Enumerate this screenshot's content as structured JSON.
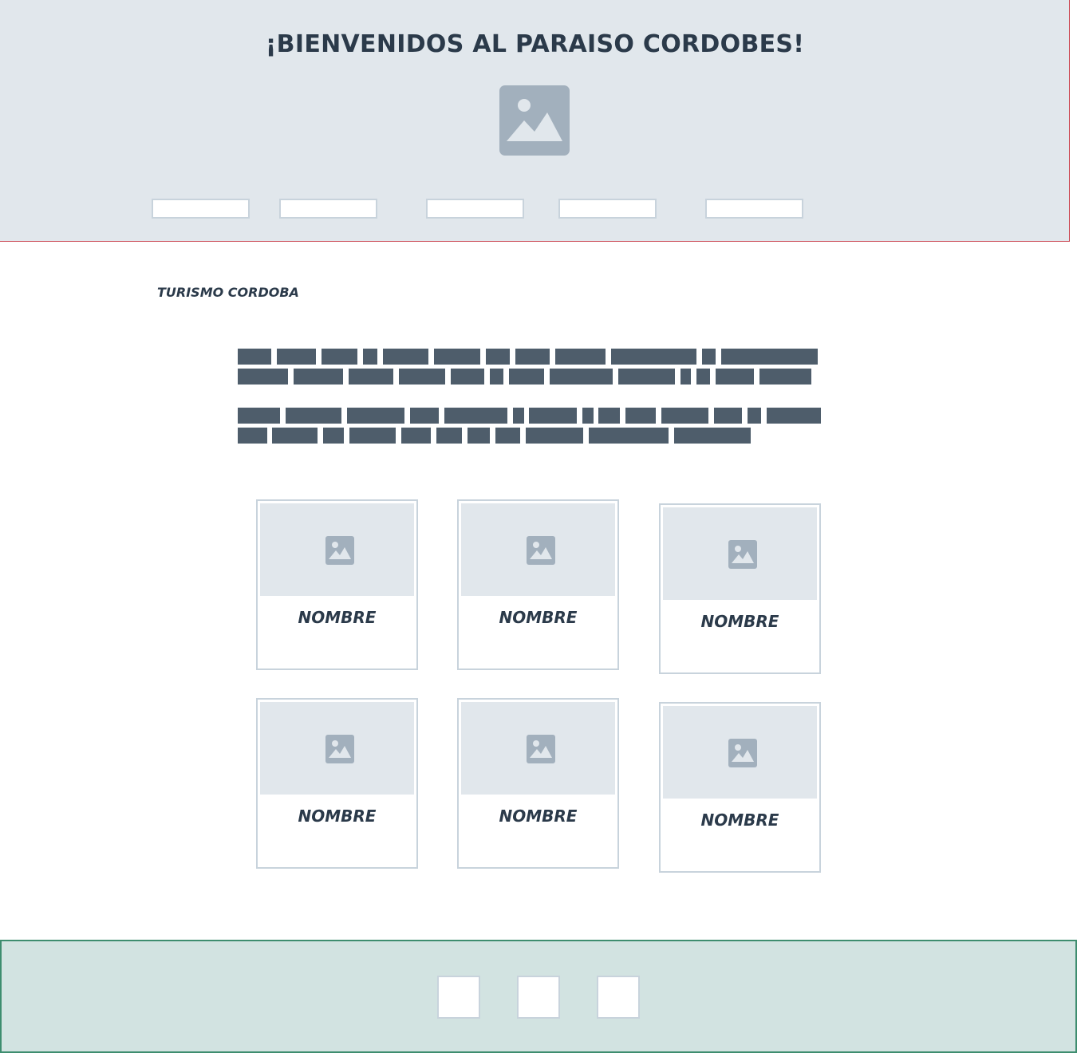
{
  "header": {
    "title": "¡BIENVENIDOS AL PARAISO CORDOBES!",
    "logo_icon": "image-placeholder-icon",
    "nav_items": [
      "",
      "",
      "",
      "",
      ""
    ]
  },
  "main": {
    "section_title": "TURISMO CORDOBA",
    "intro_text_lines": 4,
    "cards": [
      {
        "label": "NOMBRE",
        "icon": "image-placeholder-icon"
      },
      {
        "label": "NOMBRE",
        "icon": "image-placeholder-icon"
      },
      {
        "label": "NOMBRE",
        "icon": "image-placeholder-icon"
      },
      {
        "label": "NOMBRE",
        "icon": "image-placeholder-icon"
      },
      {
        "label": "NOMBRE",
        "icon": "image-placeholder-icon"
      },
      {
        "label": "NOMBRE",
        "icon": "image-placeholder-icon"
      }
    ]
  },
  "footer": {
    "social_links": [
      "",
      "",
      ""
    ]
  },
  "colors": {
    "header_bg": "#e1e7ec",
    "header_border": "#c9434f",
    "text_dark": "#2b3a4a",
    "placeholder_text": "#4e5d6b",
    "image_icon": "#a2b0bd",
    "card_border": "#c8d3dc",
    "footer_bg": "#d2e3e1",
    "footer_border": "#3e8d6f"
  }
}
